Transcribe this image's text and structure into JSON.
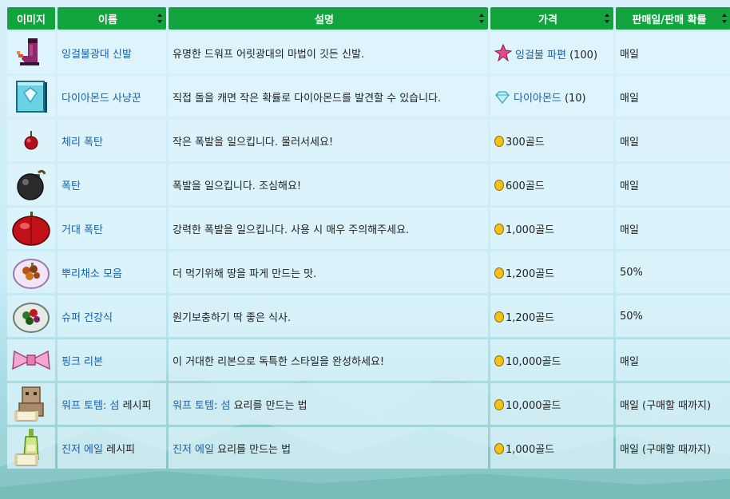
{
  "headers": {
    "image": "이미지",
    "name": "이름",
    "description": "설명",
    "price": "가격",
    "sold": "판매일/판매 확률"
  },
  "rows": [
    {
      "icon": "boots-icon",
      "name": "잉걸불광대 신발",
      "name_rest": "",
      "desc_link": "",
      "desc": "유명한 드워프 어릿광대의 마법이 깃든 신발.",
      "price_icon": "cinder-shard-icon",
      "price_link": "잉걸불 파편",
      "price": " (100)",
      "sold": "매일"
    },
    {
      "icon": "diamond-book-icon",
      "name": "다이아몬드 사냥꾼",
      "name_rest": "",
      "desc_link": "",
      "desc": "직접 돌을 캐면 작은 확률로 다이아몬드를 발견할 수 있습니다.",
      "price_icon": "diamond-icon",
      "price_link": "다이아몬드",
      "price": " (10)",
      "sold": "매일"
    },
    {
      "icon": "cherry-bomb-icon",
      "name": "체리 폭탄",
      "name_rest": "",
      "desc_link": "",
      "desc": "작은 폭발을 일으킵니다. 물러서세요!",
      "price_icon": "coin-icon",
      "price_link": "",
      "price": "300골드",
      "sold": "매일"
    },
    {
      "icon": "bomb-icon",
      "name": "폭탄",
      "name_rest": "",
      "desc_link": "",
      "desc": "폭발을 일으킵니다. 조심해요!",
      "price_icon": "coin-icon",
      "price_link": "",
      "price": "600골드",
      "sold": "매일"
    },
    {
      "icon": "mega-bomb-icon",
      "name": "거대 폭탄",
      "name_rest": "",
      "desc_link": "",
      "desc": "강력한 폭발을 일으킵니다. 사용 시 매우 주의해주세요.",
      "price_icon": "coin-icon",
      "price_link": "",
      "price": "1,000골드",
      "sold": "매일"
    },
    {
      "icon": "root-platter-icon",
      "name": "뿌리채소 모음",
      "name_rest": "",
      "desc_link": "",
      "desc": "더 먹기위해 땅을 파게 만드는 맛.",
      "price_icon": "coin-icon",
      "price_link": "",
      "price": "1,200골드",
      "sold": "50%"
    },
    {
      "icon": "super-meal-icon",
      "name": "슈퍼 건강식",
      "name_rest": "",
      "desc_link": "",
      "desc": "원기보충하기 딱 좋은 식사.",
      "price_icon": "coin-icon",
      "price_link": "",
      "price": "1,200골드",
      "sold": "50%"
    },
    {
      "icon": "pink-bow-icon",
      "name": "핑크 리본",
      "name_rest": "",
      "desc_link": "",
      "desc": "이 거대한 리본으로 독특한 스타일을 완성하세요!",
      "price_icon": "coin-icon",
      "price_link": "",
      "price": "10,000골드",
      "sold": "매일"
    },
    {
      "icon": "warp-totem-recipe-icon",
      "name": "워프 토템: 섬",
      "name_rest": " 레시피",
      "desc_link": "워프 토템: 섬",
      "desc": " 요리를 만드는 법",
      "price_icon": "coin-icon",
      "price_link": "",
      "price": "10,000골드",
      "sold": "매일 (구매할 때까지)"
    },
    {
      "icon": "ginger-ale-recipe-icon",
      "name": "진저 에일",
      "name_rest": " 레시피",
      "desc_link": "진저 에일",
      "desc": " 요리를 만드는 법",
      "price_icon": "coin-icon",
      "price_link": "",
      "price": "1,000골드",
      "sold": "매일 (구매할 때까지)"
    }
  ]
}
